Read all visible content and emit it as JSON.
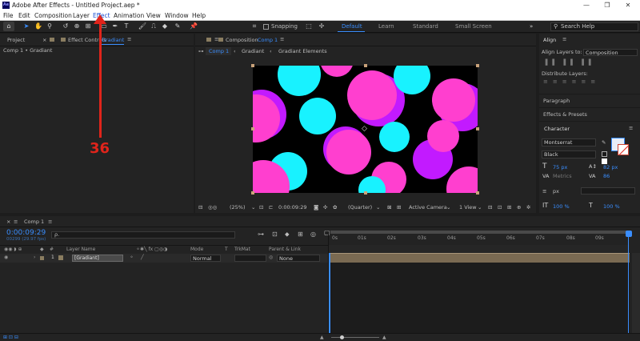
{
  "window": {
    "title": "Adobe After Effects - Untitled Project.aep *",
    "app_icon_text": "Ae",
    "minimize": "—",
    "restore": "❐",
    "close": "✕"
  },
  "menu": [
    "File",
    "Edit",
    "Composition",
    "Layer",
    "Effect",
    "Animation",
    "View",
    "Window",
    "Help"
  ],
  "menu_highlight": "Effect",
  "toolbar": {
    "snapping_label": "Snapping",
    "workspaces": [
      "Default",
      "Learn",
      "Standard",
      "Small Screen"
    ],
    "active_workspace": "Default",
    "overflow": "»",
    "search_placeholder": "Search Help"
  },
  "project_panel": {
    "tab_project": "Project",
    "tab_effect_controls": "Effect Controls",
    "effect_controls_layer": "Gradiant",
    "breadcrumb": "Comp 1 • Gradiant"
  },
  "composition_panel": {
    "tab_label": "Composition",
    "tab_comp": "Comp 1",
    "subtabs": [
      "Comp 1",
      "Gradiant",
      "Gradiant Elements"
    ],
    "zoom": "(25%)",
    "timecode": "0:00:09:29",
    "resolution": "(Quarter)",
    "camera": "Active Camera",
    "views": "1 View"
  },
  "right_panel": {
    "align_title": "Align",
    "align_layers_to": "Align Layers to:",
    "align_target": "Composition",
    "distribute_layers": "Distribute Layers:",
    "sections": [
      "Paragraph",
      "Effects & Presets"
    ],
    "character_title": "Character",
    "font": "Montserrat",
    "style": "Black",
    "font_size": "75 px",
    "leading": "82 px",
    "kerning": "Metrics",
    "tracking": "86",
    "stroke_unit": "px",
    "vscale": "100 %",
    "hscale": "100 %"
  },
  "timeline": {
    "tab": "Comp 1",
    "timecode": "0:00:09:29",
    "frames": "00299 (29.97 fps)",
    "search_placeholder": "ρ.",
    "col_layer_name": "Layer Name",
    "col_mode": "Mode",
    "col_t": "T",
    "col_trkmat": "TrkMat",
    "col_parent": "Parent & Link",
    "layer_number": "1",
    "layer_name": "[Gradiant]",
    "layer_mode": "Normal",
    "layer_parent": "None",
    "ruler": [
      "0s",
      "01s",
      "02s",
      "03s",
      "04s",
      "05s",
      "06s",
      "07s",
      "08s",
      "09s"
    ]
  },
  "annotation": {
    "number": "36"
  },
  "colors": {
    "accent": "#3a8eff",
    "magenta": "#ff3fcf",
    "purple": "#c21aff",
    "cyan": "#18f2ff",
    "annotation": "#e0241b"
  }
}
